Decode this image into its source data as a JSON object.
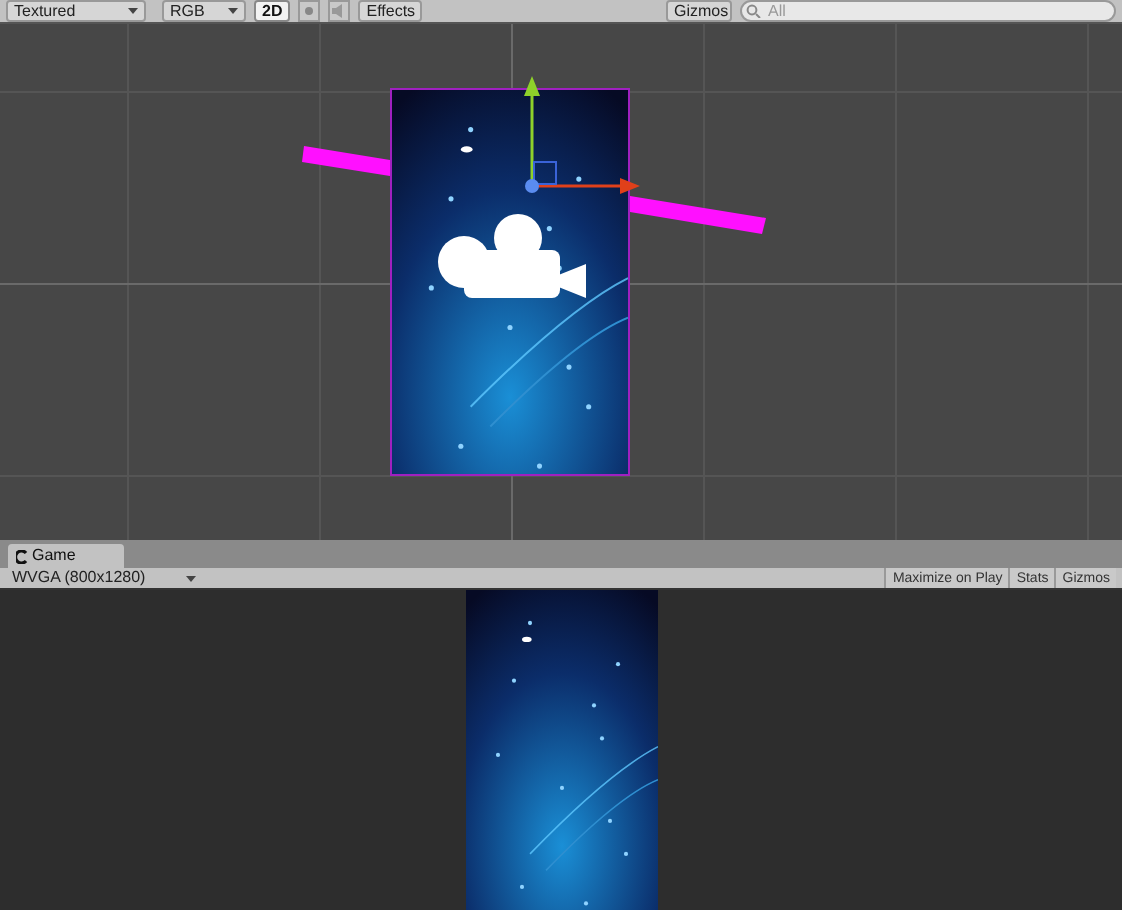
{
  "scene_toolbar": {
    "render_mode": "Textured",
    "channel": "RGB",
    "mode_2d": {
      "label": "2D",
      "selected": true
    },
    "effects": "Effects",
    "gizmos": "Gizmos",
    "search_placeholder": "All"
  },
  "scene": {
    "selected": true
  },
  "game_tab": {
    "label": "Game",
    "selected": true
  },
  "game_toolbar": {
    "resolution": "WVGA (800x1280)",
    "buttons": [
      {
        "label": "Maximize on Play",
        "selected": false
      },
      {
        "label": "Stats",
        "selected": false
      },
      {
        "label": "Gizmos",
        "selected": false
      }
    ]
  }
}
